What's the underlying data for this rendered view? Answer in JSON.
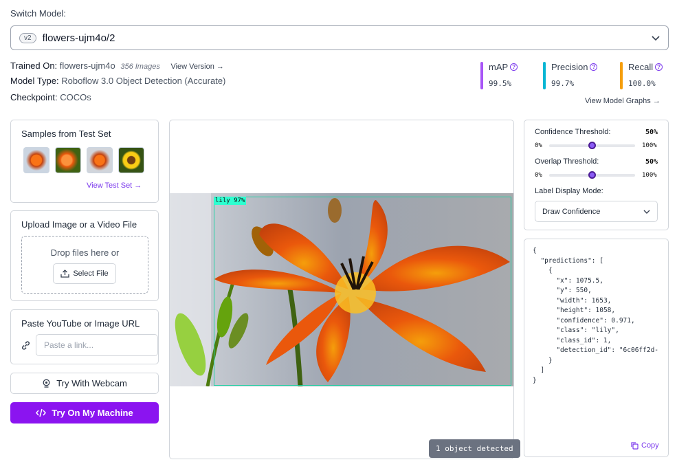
{
  "header": {
    "switch_label": "Switch Model:",
    "version_badge": "v2",
    "model_name": "flowers-ujm4o/2"
  },
  "meta": {
    "trained_on_label": "Trained On:",
    "trained_on_value": "flowers-ujm4o",
    "images_count": "356 Images",
    "view_version_link": "View Version →",
    "model_type_label": "Model Type:",
    "model_type_value": "Roboflow 3.0 Object Detection (Accurate)",
    "checkpoint_label": "Checkpoint:",
    "checkpoint_value": "COCOs"
  },
  "metrics": [
    {
      "name": "mAP",
      "value": "99.5%",
      "color": "#a855f7"
    },
    {
      "name": "Precision",
      "value": "99.7%",
      "color": "#06b6d4"
    },
    {
      "name": "Recall",
      "value": "100.0%",
      "color": "#f59e0b"
    }
  ],
  "view_graphs_link": "View Model Graphs →",
  "samples": {
    "title": "Samples from Test Set",
    "view_link": "View Test Set →"
  },
  "upload": {
    "title": "Upload Image or a Video File",
    "drop_text": "Drop files here or",
    "select_button": "Select File"
  },
  "paste": {
    "title": "Paste YouTube or Image URL",
    "placeholder": "Paste a link..."
  },
  "webcam_button": "Try With Webcam",
  "machine_button": "Try On My Machine",
  "detection": {
    "label": "lily 97%",
    "count_text": "1 object detected"
  },
  "settings": {
    "confidence_label": "Confidence Threshold:",
    "confidence_value": "50%",
    "confidence_level": 0.5,
    "overlap_label": "Overlap Threshold:",
    "overlap_value": "50%",
    "overlap_level": 0.5,
    "min": "0%",
    "max": "100%",
    "label_mode_label": "Label Display Mode:",
    "label_mode_value": "Draw Confidence"
  },
  "json_output": "{\n  \"predictions\": [\n    {\n      \"x\": 1075.5,\n      \"y\": 550,\n      \"width\": 1653,\n      \"height\": 1058,\n      \"confidence\": 0.971,\n      \"class\": \"lily\",\n      \"class_id\": 1,\n      \"detection_id\": \"6c06ff2d-\n    }\n  ]\n}",
  "copy_label": "Copy"
}
